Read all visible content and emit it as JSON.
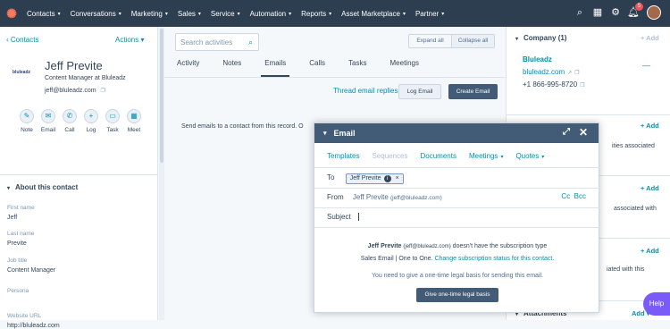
{
  "nav": {
    "items": [
      "Contacts",
      "Conversations",
      "Marketing",
      "Sales",
      "Service",
      "Automation",
      "Reports",
      "Asset Marketplace",
      "Partner"
    ],
    "notification_count": "5"
  },
  "contact": {
    "back_label": "Contacts",
    "actions_label": "Actions",
    "company_logo_text": "bluleadz",
    "name": "Jeff Previte",
    "title": "Content Manager at Bluleadz",
    "email": "jeff@bluleadz.com",
    "activity_buttons": [
      "Note",
      "Email",
      "Call",
      "Log",
      "Task",
      "Meet"
    ],
    "about_header": "About this contact",
    "properties": [
      {
        "label": "First name",
        "value": "Jeff"
      },
      {
        "label": "Last name",
        "value": "Previte"
      },
      {
        "label": "Job title",
        "value": "Content Manager"
      },
      {
        "label": "Persona",
        "value": ""
      },
      {
        "label": "Website URL",
        "value": "http://bluleadz.com"
      }
    ]
  },
  "timeline": {
    "search_placeholder": "Search activities",
    "expand_all": "Expand all",
    "collapse_all": "Collapse all",
    "tabs": [
      "Activity",
      "Notes",
      "Emails",
      "Calls",
      "Tasks",
      "Meetings"
    ],
    "active_tab": "Emails",
    "thread_link": "Thread email replies",
    "log_email": "Log Email",
    "create_email": "Create Email",
    "empty_text": "Send emails to a contact from this record. O"
  },
  "sidebar": {
    "company_header": "Company (1)",
    "add_label": "+ Add",
    "company_name": "Bluleadz",
    "company_domain": "bluleadz.com",
    "company_phone": "+1 866-995-8720",
    "partial_texts": [
      "ities associated",
      "associated with",
      "iated with this"
    ],
    "attachments": "Attachments"
  },
  "email_modal": {
    "title": "Email",
    "tabs": {
      "templates": "Templates",
      "sequences": "Sequences",
      "documents": "Documents",
      "meetings": "Meetings",
      "quotes": "Quotes"
    },
    "to_label": "To",
    "to_chip": "Jeff Previte",
    "from_label": "From",
    "from_name": "Jeff Previte",
    "from_email": "(jeff@bluleadz.com)",
    "cc": "Cc",
    "bcc": "Bcc",
    "subject_label": "Subject",
    "notice_name": "Jeff Previte",
    "notice_email": "(jeff@bluleadz.com)",
    "notice_rest": "doesn't have the subscription type",
    "notice_sub": "Sales Email | One to One.",
    "notice_link": "Change subscription status for this contact.",
    "legal_text": "You need to give a one-time legal basis for sending this email.",
    "legal_button": "Give one-time legal basis"
  },
  "help_label": "Help",
  "colors": {
    "nav": "#2d3e50",
    "accent": "#0091ae",
    "primary_button": "#425b76",
    "logo": "#ff7a59"
  }
}
